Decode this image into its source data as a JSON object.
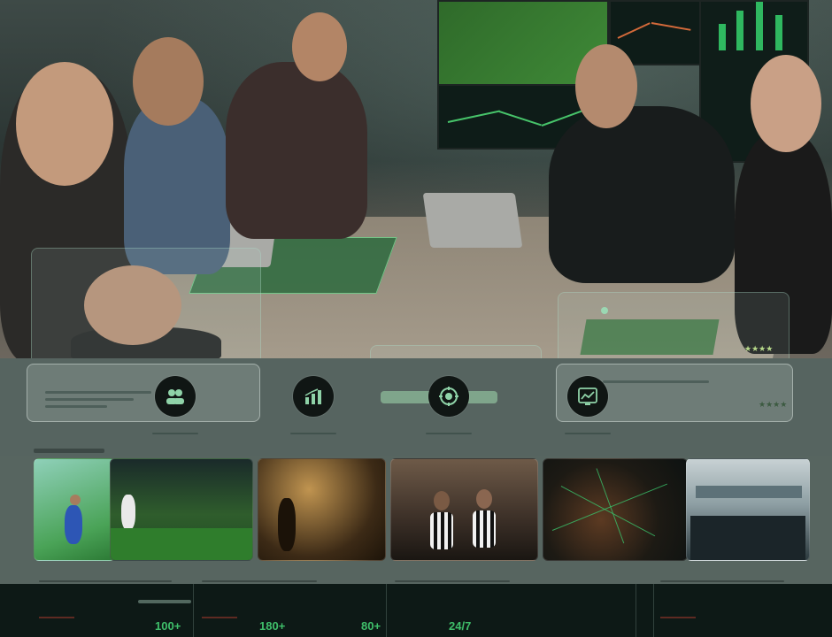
{
  "hero": {
    "stars_left": "★★★★",
    "stars_right": "★★★★"
  },
  "features": [
    {
      "icon": "team-icon",
      "caption": ""
    },
    {
      "icon": "bar-chart-icon",
      "caption": ""
    },
    {
      "icon": "target-icon",
      "caption": ""
    },
    {
      "icon": "dashboard-chart-icon",
      "caption": ""
    }
  ],
  "stats": {
    "items": [
      {
        "value": "100+"
      },
      {
        "value": "180+"
      },
      {
        "value": "80+"
      },
      {
        "value": "24/7"
      }
    ]
  },
  "colors": {
    "accent_green": "#3fbf6a",
    "dark_bg": "#0d1916",
    "panel_glass": "#dce8e4"
  }
}
